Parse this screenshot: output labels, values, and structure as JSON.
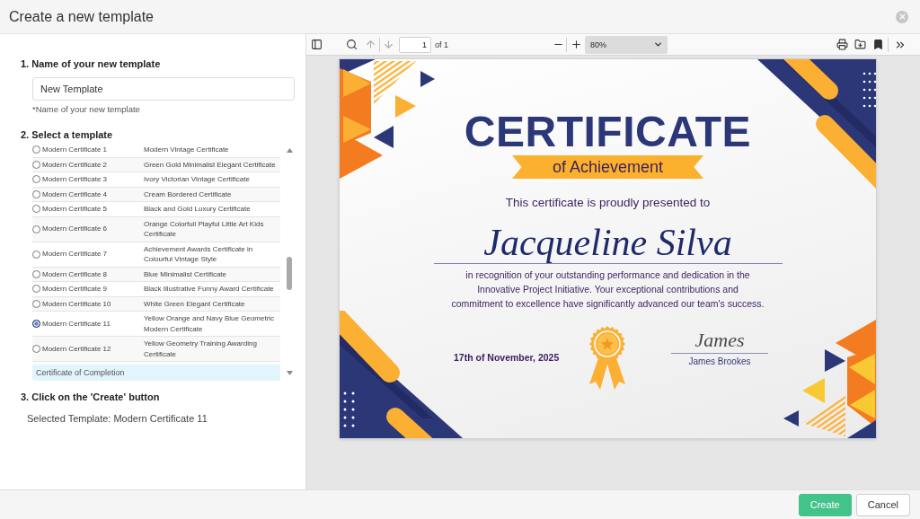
{
  "dialog": {
    "title": "Create a new template"
  },
  "name_section": {
    "heading": "1. Name of your new template",
    "input": {
      "value": "New Template"
    },
    "hint": "*Name of your new template"
  },
  "template_section": {
    "heading": "2. Select a template",
    "templates": [
      {
        "name": "Modern Certificate 1",
        "description": "Modern Vintage Certificate",
        "selected": false
      },
      {
        "name": "Modern Certificate 2",
        "description": "Green Gold Minimalist Elegant Certificate",
        "selected": false
      },
      {
        "name": "Modern Certificate 3",
        "description": "Ivory Victorian Vintage Certificate",
        "selected": false
      },
      {
        "name": "Modern Certificate 4",
        "description": "Cream Bordered Certificate",
        "selected": false
      },
      {
        "name": "Modern Certificate 5",
        "description": "Black and Gold Luxury Certificate",
        "selected": false
      },
      {
        "name": "Modern Certificate 6",
        "description": "Orange Colorfull Playful Little Art Kids Certificate",
        "selected": false
      },
      {
        "name": "Modern Certificate 7",
        "description": "Achievement Awards Certificate in Colourful Vintage Style",
        "selected": false
      },
      {
        "name": "Modern Certificate 8",
        "description": "Blue Minimalist Certificate",
        "selected": false
      },
      {
        "name": "Modern Certificate 9",
        "description": "Black Illustrative Funny Award Certificate",
        "selected": false
      },
      {
        "name": "Modern Certificate 10",
        "description": "White Green Elegant Certificate",
        "selected": false
      },
      {
        "name": "Modern Certificate 11",
        "description": "Yellow Orange and Navy Blue Geometric Modern Certificate",
        "selected": true
      },
      {
        "name": "Modern Certificate 12",
        "description": "Yellow Geometry Training Awarding Certificate",
        "selected": false
      }
    ],
    "next_group": "Certificate of Completion"
  },
  "create_section": {
    "heading": "3. Click on the 'Create' button",
    "selected_template": "Selected Template: Modern Certificate 11"
  },
  "pdf_viewer": {
    "toolbar": {
      "nav_buttons": [
        {
          "kind": "previous",
          "disabled": true
        },
        {
          "kind": "next",
          "disabled": true
        }
      ],
      "page_input": "1",
      "page_count": "of 1",
      "zoom": "80%"
    },
    "certificate": {
      "title": "CERTIFICATE",
      "subtitle": "of Achievement",
      "presented": "This certificate is proudly presented to",
      "recipient": "Jacqueline Silva",
      "citation": "in recognition of your outstanding performance and dedication in the Innovative Project Initiative. Your exceptional contributions and commitment to excellence have significantly advanced our team's success.",
      "date": "17th of November, 2025",
      "signature": "James",
      "signer": "James Brookes"
    }
  },
  "footer": {
    "buttons": [
      {
        "label": "Create",
        "kind": "primary"
      },
      {
        "label": "Cancel",
        "kind": "secondary"
      }
    ]
  }
}
